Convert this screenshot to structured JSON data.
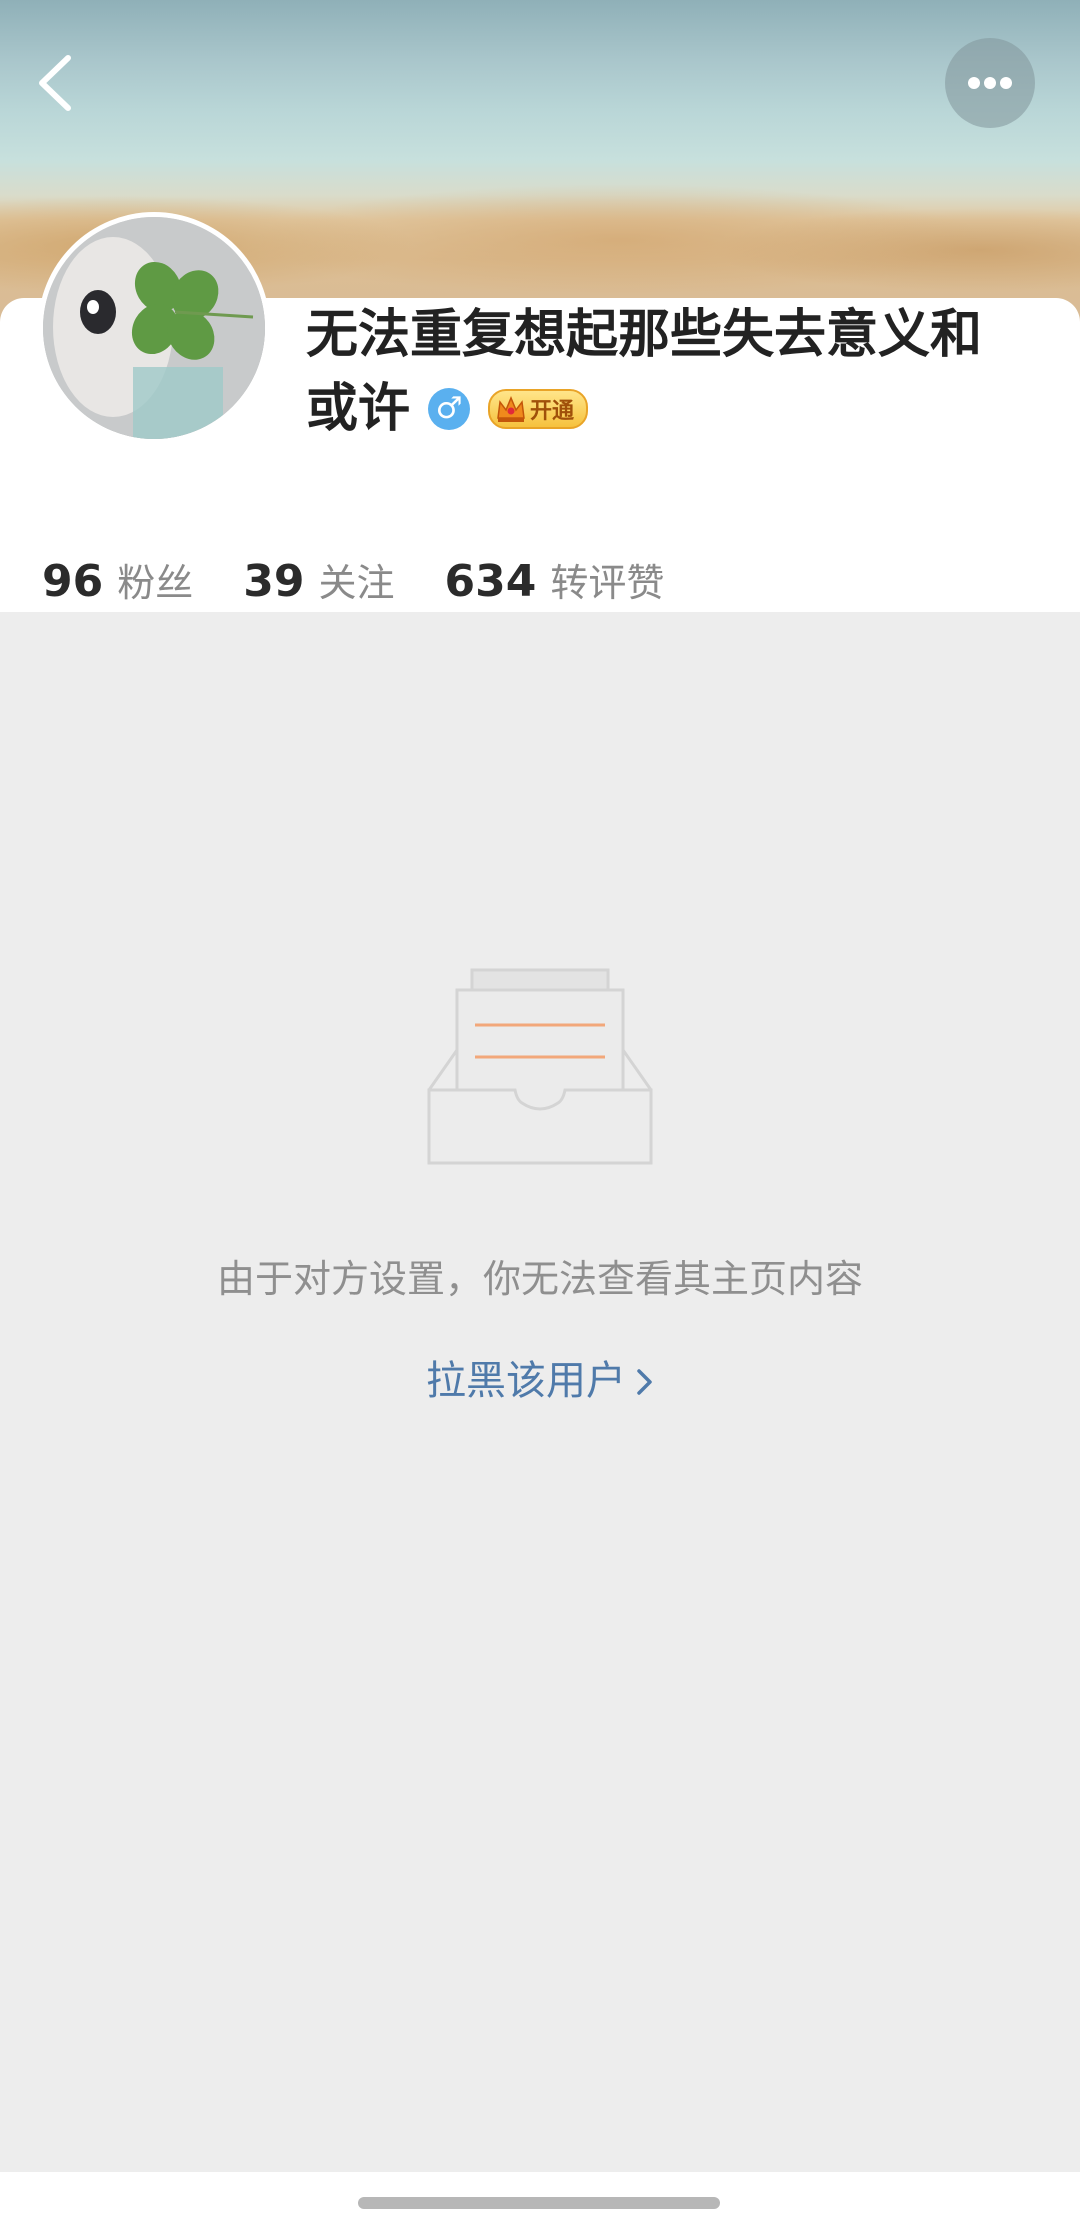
{
  "profile": {
    "name_line1": "无法重复想起那些失去意义和",
    "name_line2": "或许",
    "gender_symbol": "♂",
    "vip_label": "开通",
    "stats": [
      {
        "value": "96",
        "label": "粉丝"
      },
      {
        "value": "39",
        "label": "关注"
      },
      {
        "value": "634",
        "label": "转评赞"
      }
    ]
  },
  "empty_state": {
    "message": "由于对方设置，你无法查看其主页内容",
    "block_link": "拉黑该用户"
  },
  "icons": {
    "back": "chevron-left-icon",
    "more": "more-dots-icon",
    "gender": "male-icon",
    "vip": "crown-icon",
    "empty": "empty-inbox-icon"
  },
  "colors": {
    "link": "#4f7aaa",
    "gender_badge": "#5ab0ef",
    "vip_gold": "#f6c23e",
    "illustration_lines": "#f2a77a"
  }
}
